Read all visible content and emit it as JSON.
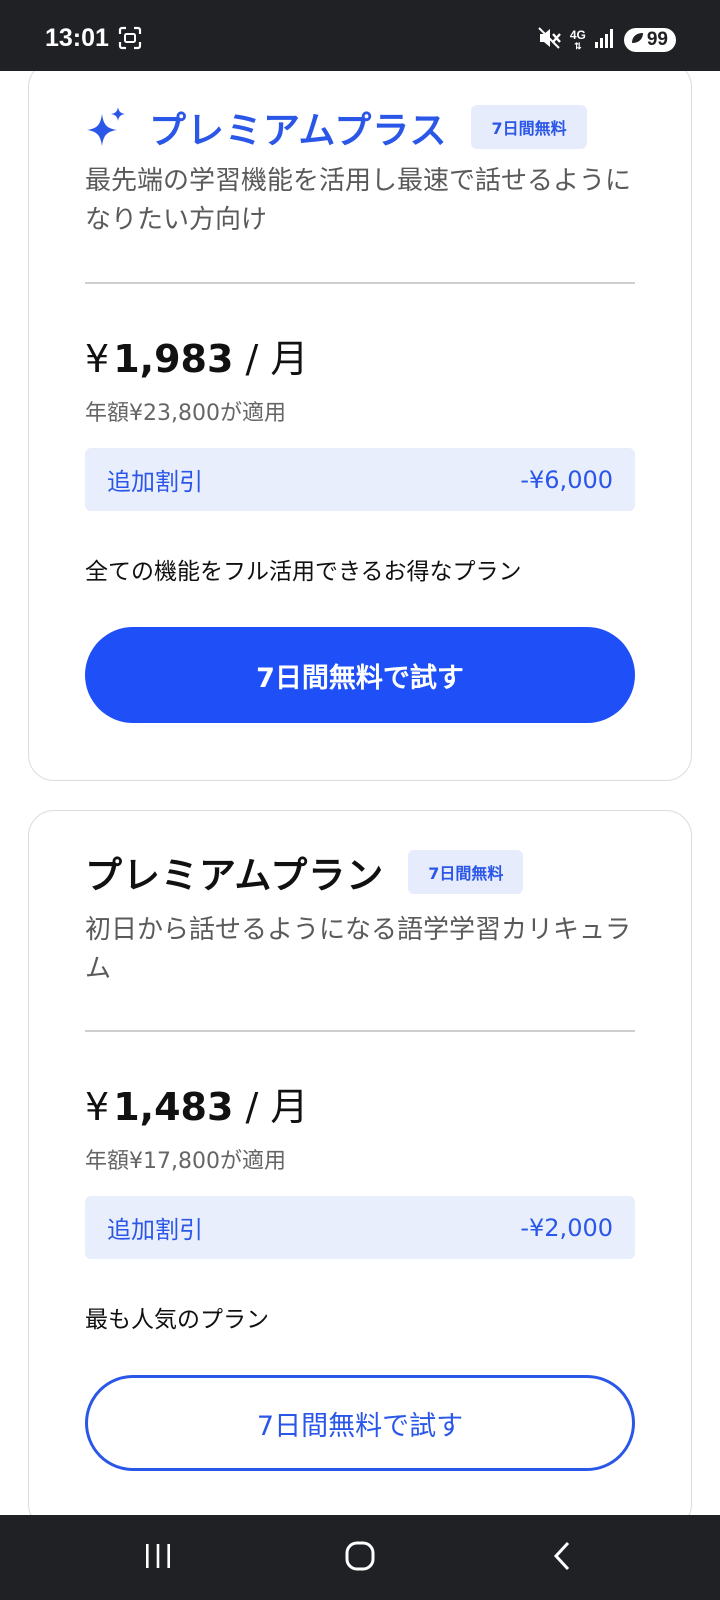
{
  "status_bar": {
    "time": "13:01",
    "network": "4G",
    "battery": "99"
  },
  "plans": [
    {
      "title": "プレミアムプラス",
      "badge": "7日間無料",
      "description": "最先端の学習機能を活用し最速で話せるようになりたい方向け",
      "price_yen": "¥",
      "price_amount": "1,983",
      "price_per": " / 月",
      "annual_note": "年額¥23,800が適用",
      "discount_label": "追加割引",
      "discount_value": "-¥6,000",
      "tagline": "全ての機能をフル活用できるお得なプラン",
      "cta_label": "7日間無料で試す"
    },
    {
      "title": "プレミアムプラン",
      "badge": "7日間無料",
      "description": "初日から話せるようになる語学学習カリキュラム",
      "price_yen": "¥",
      "price_amount": "1,483",
      "price_per": " / 月",
      "annual_note": "年額¥17,800が適用",
      "discount_label": "追加割引",
      "discount_value": "-¥2,000",
      "tagline": "最も人気のプラン",
      "cta_label": "7日間無料で試す"
    }
  ],
  "colors": {
    "accent": "#2b57e8",
    "cta_fill": "#1f4ff7",
    "discount_bg": "#e9eefc",
    "system_bar": "#202125"
  },
  "icons": {
    "plus_plan": "sparkle-icon",
    "nav": [
      "recent-apps-icon",
      "home-icon",
      "back-icon"
    ]
  }
}
